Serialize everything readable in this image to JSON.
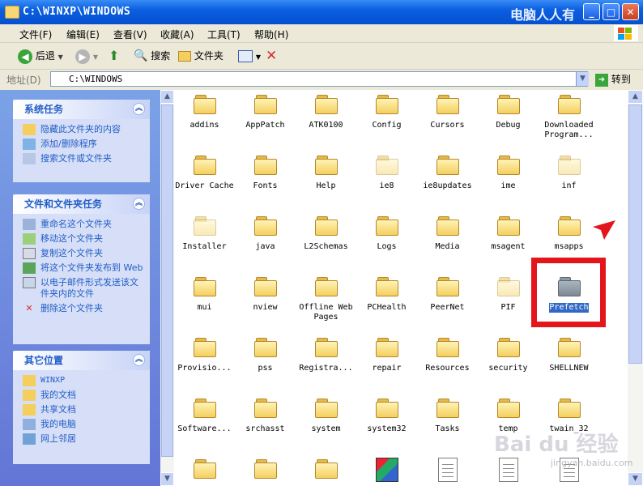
{
  "window": {
    "title": "C:\\WINXP\\WINDOWS",
    "watermark": "电脑人人有"
  },
  "menu": [
    "文件(F)",
    "编辑(E)",
    "查看(V)",
    "收藏(A)",
    "工具(T)",
    "帮助(H)"
  ],
  "toolbar": {
    "back": "后退",
    "search": "搜索",
    "folders": "文件夹"
  },
  "address": {
    "label": "地址(D)",
    "value": "C:\\WINDOWS",
    "go": "转到"
  },
  "sidebar": {
    "system_tasks": {
      "title": "系统任务",
      "items": [
        "隐藏此文件夹的内容",
        "添加/删除程序",
        "搜索文件或文件夹"
      ]
    },
    "file_tasks": {
      "title": "文件和文件夹任务",
      "items": [
        "重命名这个文件夹",
        "移动这个文件夹",
        "复制这个文件夹",
        "将这个文件夹发布到 Web",
        "以电子邮件形式发送该文件夹内的文件",
        "删除这个文件夹"
      ]
    },
    "other_places": {
      "title": "其它位置",
      "items": [
        "WINXP",
        "我的文档",
        "共享文档",
        "我的电脑",
        "网上邻居"
      ]
    }
  },
  "files": [
    [
      "addins",
      "AppPatch",
      "ATK0100",
      "Config",
      "Cursors",
      "Debug",
      "Downloaded Program..."
    ],
    [
      "Driver Cache",
      "Fonts",
      "Help",
      "ie8",
      "ie8updates",
      "ime",
      "inf"
    ],
    [
      "Installer",
      "java",
      "L2Schemas",
      "Logs",
      "Media",
      "msagent",
      "msapps"
    ],
    [
      "mui",
      "nview",
      "Offline Web Pages",
      "PCHealth",
      "PeerNet",
      "PIF",
      "Prefetch"
    ],
    [
      "Provisio...",
      "pss",
      "Registra...",
      "repair",
      "Resources",
      "security",
      "SHELLNEW"
    ],
    [
      "Software...",
      "srchasst",
      "system",
      "system32",
      "Tasks",
      "temp",
      "twain_32"
    ]
  ],
  "selected_file": "Prefetch",
  "watermark_bottom": {
    "brand": "Bai du 经验",
    "url": "jingyan.baidu.com"
  },
  "colors": {
    "accent": "#316ac5",
    "highlight": "#e4151b"
  }
}
